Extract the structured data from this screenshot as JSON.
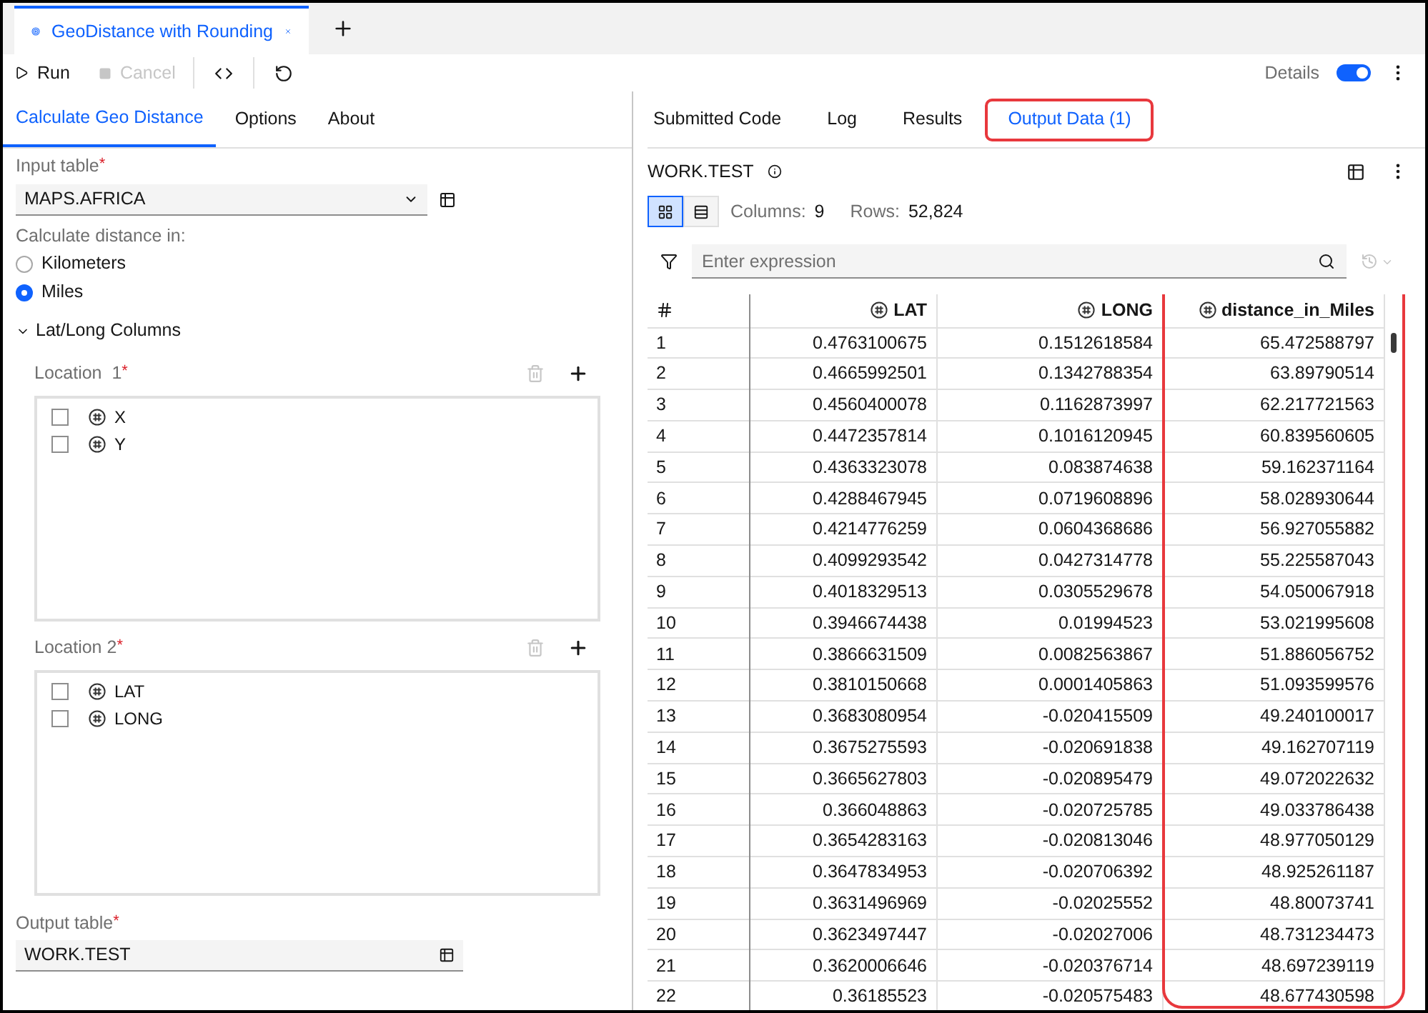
{
  "document_tabs": [
    {
      "label": "GeoDistance with Rounding",
      "selected": true
    }
  ],
  "toolbar": {
    "run": "Run",
    "cancel": "Cancel",
    "cancel_disabled": true,
    "details": {
      "label": "Details",
      "on": true
    }
  },
  "left_tabs": [
    {
      "label": "Calculate Geo Distance",
      "selected": true
    },
    {
      "label": "Options",
      "selected": false
    },
    {
      "label": "About",
      "selected": false
    }
  ],
  "input_table": {
    "label": "Input table",
    "marker": "*",
    "value": "MAPS.AFRICA"
  },
  "units": {
    "label": "Calculate distance in:",
    "options": [
      {
        "label": "Kilometers",
        "selected": false
      },
      {
        "label": "Miles",
        "selected": true
      }
    ]
  },
  "section": {
    "label": "Lat/Long Columns",
    "expanded": true
  },
  "locations": [
    {
      "label": "Location  1",
      "marker": "*",
      "columns": [
        {
          "name": "X",
          "checked": false
        },
        {
          "name": "Y",
          "checked": false
        }
      ]
    },
    {
      "label": "Location 2",
      "marker": "*",
      "columns": [
        {
          "name": "LAT",
          "checked": false
        },
        {
          "name": "LONG",
          "checked": false
        }
      ]
    }
  ],
  "output_table": {
    "label": "Output table",
    "marker": "*",
    "value": "WORK.TEST"
  },
  "right_tabs": [
    {
      "label": "Submitted Code",
      "selected": false,
      "highlighted": false
    },
    {
      "label": "Log",
      "selected": false,
      "highlighted": false
    },
    {
      "label": "Results",
      "selected": false,
      "highlighted": false
    },
    {
      "label": "Output Data (1)",
      "selected": true,
      "highlighted": true
    }
  ],
  "dataset": {
    "name": "WORK.TEST",
    "view_modes": [
      {
        "kind": "grid",
        "selected": true
      },
      {
        "kind": "record",
        "selected": false
      }
    ],
    "columns_label": "Columns:",
    "columns_value": "9",
    "rows_label": "Rows:",
    "rows_value": "52,824"
  },
  "filter": {
    "placeholder": "Enter expression"
  },
  "table": {
    "columns": [
      {
        "kind": "row_number"
      },
      {
        "kind": "numeric",
        "label": "LAT",
        "highlighted": false
      },
      {
        "kind": "numeric",
        "label": "LONG",
        "highlighted": false
      },
      {
        "kind": "numeric",
        "label": "distance_in_Miles",
        "highlighted": true
      }
    ],
    "rows": [
      [
        "1",
        "0.4763100675",
        "0.1512618584",
        "65.472588797"
      ],
      [
        "2",
        "0.4665992501",
        "0.1342788354",
        "63.89790514"
      ],
      [
        "3",
        "0.4560400078",
        "0.1162873997",
        "62.217721563"
      ],
      [
        "4",
        "0.4472357814",
        "0.1016120945",
        "60.839560605"
      ],
      [
        "5",
        "0.4363323078",
        "0.083874638",
        "59.162371164"
      ],
      [
        "6",
        "0.4288467945",
        "0.0719608896",
        "58.028930644"
      ],
      [
        "7",
        "0.4214776259",
        "0.0604368686",
        "56.927055882"
      ],
      [
        "8",
        "0.4099293542",
        "0.0427314778",
        "55.225587043"
      ],
      [
        "9",
        "0.4018329513",
        "0.0305529678",
        "54.050067918"
      ],
      [
        "10",
        "0.3946674438",
        "0.01994523",
        "53.021995608"
      ],
      [
        "11",
        "0.3866631509",
        "0.0082563867",
        "51.886056752"
      ],
      [
        "12",
        "0.3810150668",
        "0.0001405863",
        "51.093599576"
      ],
      [
        "13",
        "0.3683080954",
        "-0.020415509",
        "49.240100017"
      ],
      [
        "14",
        "0.3675275593",
        "-0.020691838",
        "49.162707119"
      ],
      [
        "15",
        "0.3665627803",
        "-0.020895479",
        "49.072022632"
      ],
      [
        "16",
        "0.366048863",
        "-0.020725785",
        "49.033786438"
      ],
      [
        "17",
        "0.3654283163",
        "-0.020813046",
        "48.977050129"
      ],
      [
        "18",
        "0.3647834953",
        "-0.020706392",
        "48.925261187"
      ],
      [
        "19",
        "0.3631496969",
        "-0.02025552",
        "48.80073741"
      ],
      [
        "20",
        "0.3623497447",
        "-0.02027006",
        "48.731234473"
      ],
      [
        "21",
        "0.3620006646",
        "-0.020376714",
        "48.697239119"
      ],
      [
        "22",
        "0.36185523",
        "-0.020575483",
        "48.677430598"
      ]
    ]
  }
}
